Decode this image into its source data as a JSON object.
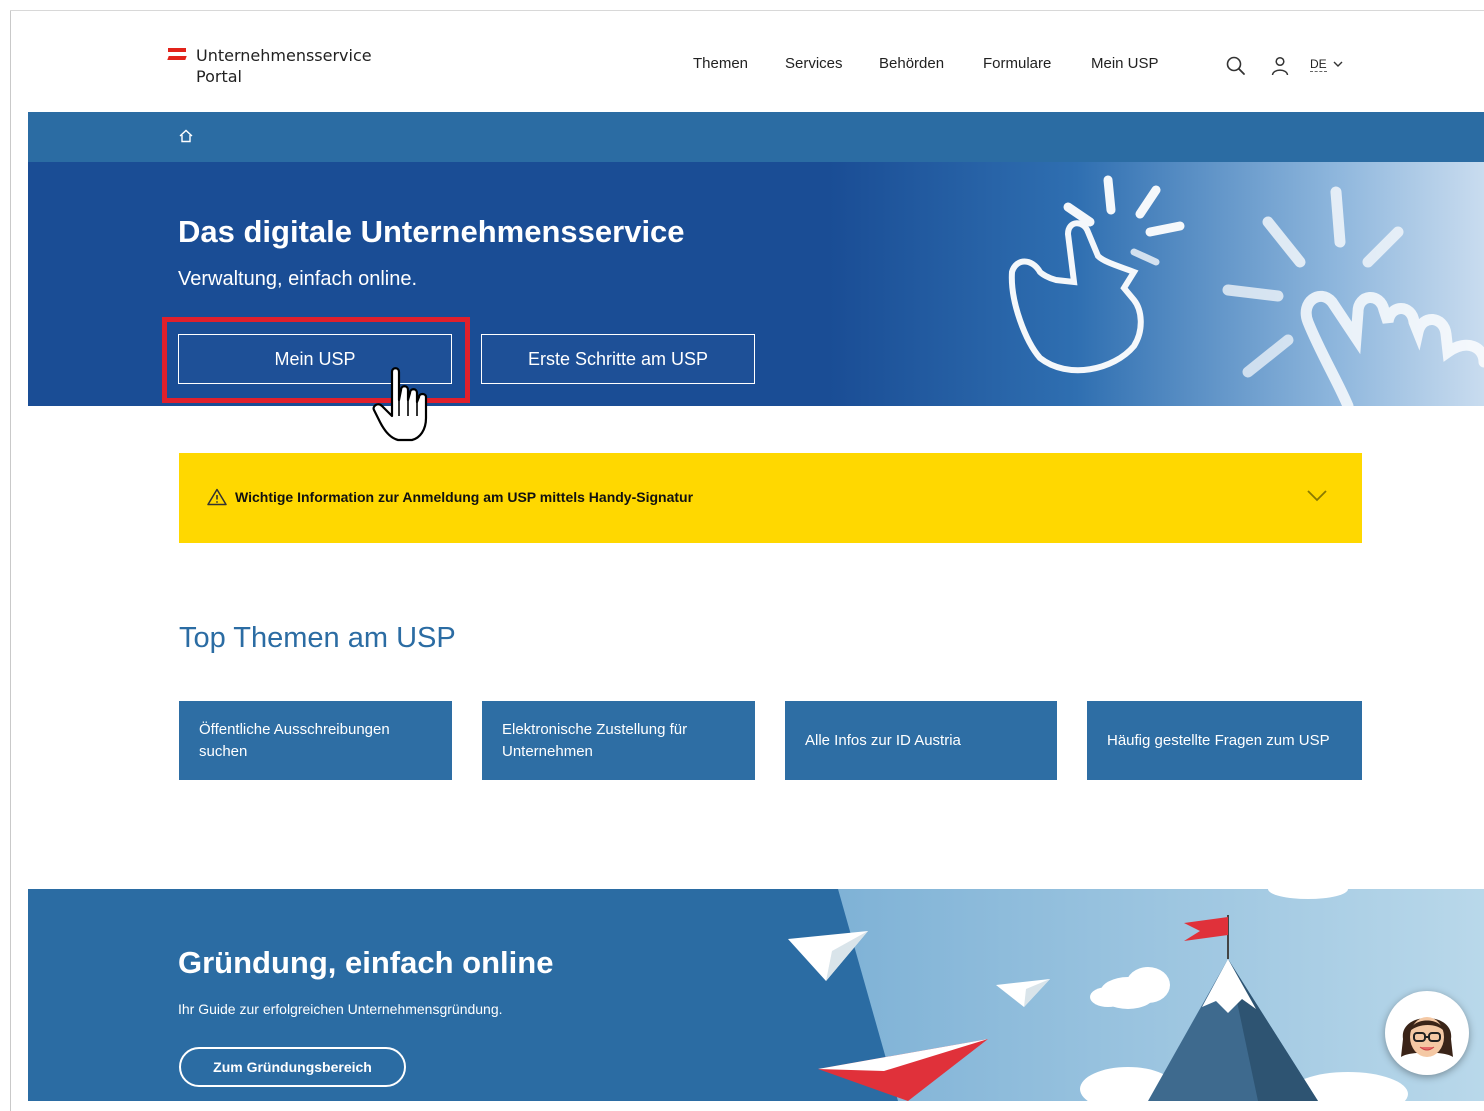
{
  "header": {
    "logo_line1": "Unternehmensservice",
    "logo_line2": "Portal",
    "nav": [
      "Themen",
      "Services",
      "Behörden",
      "Formulare",
      "Mein USP"
    ],
    "lang": "DE"
  },
  "hero": {
    "title": "Das digitale Unternehmensservice",
    "subtitle": "Verwaltung, einfach online.",
    "primary_button": "Mein USP",
    "secondary_button": "Erste Schritte am USP"
  },
  "notice": {
    "text": "Wichtige Information zur Anmeldung am USP mittels Handy-Signatur"
  },
  "topics": {
    "title": "Top Themen am USP",
    "items": [
      "Öffentliche Ausschreibungen suchen",
      "Elektronische Zustellung für Unternehmen",
      "Alle Infos zur ID Austria",
      "Häufig gestellte Fragen zum USP"
    ]
  },
  "banner": {
    "title": "Gründung, einfach online",
    "subtitle": "Ihr Guide zur erfolgreichen Unternehmensgründung.",
    "button": "Zum Gründungsbereich"
  },
  "colors": {
    "brand_blue": "#2b6ca3",
    "hero_blue": "#1a4d95",
    "notice_yellow": "#ffd800",
    "highlight_red": "#e0202c"
  },
  "icons": [
    "home-icon",
    "search-icon",
    "user-icon",
    "chevron-down-icon",
    "warning-icon",
    "hand-cursor-icon",
    "chat-avatar-icon"
  ]
}
